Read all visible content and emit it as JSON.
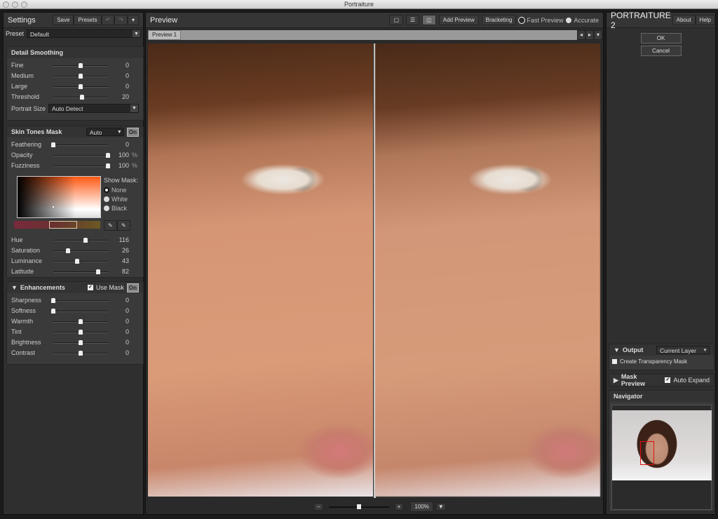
{
  "window": {
    "title": "Portraiture"
  },
  "settings": {
    "title": "Settings",
    "save": "Save",
    "presets": "Presets",
    "undo_icon": "undo-icon",
    "redo_icon": "redo-icon",
    "preset_label": "Preset",
    "preset_value": "Default"
  },
  "detail": {
    "title": "Detail Smoothing",
    "sliders": [
      {
        "label": "Fine",
        "value": "0",
        "pos": 0.5
      },
      {
        "label": "Medium",
        "value": "0",
        "pos": 0.5
      },
      {
        "label": "Large",
        "value": "0",
        "pos": 0.5
      },
      {
        "label": "Threshold",
        "value": "20",
        "pos": 0.52
      }
    ],
    "portrait_size_label": "Portrait Size",
    "portrait_size_value": "Auto Detect"
  },
  "skin": {
    "title": "Skin Tones Mask",
    "mode": "Auto",
    "on": "On",
    "sliders": [
      {
        "label": "Feathering",
        "value": "0",
        "pos": 0
      },
      {
        "label": "Opacity",
        "value": "100",
        "unit": "%",
        "pos": 1
      },
      {
        "label": "Fuzziness",
        "value": "100",
        "unit": "%",
        "pos": 1
      }
    ],
    "show_mask_label": "Show Mask:",
    "show_mask_options": [
      "None",
      "White",
      "Black"
    ],
    "show_mask_selected": "None",
    "color_sliders": [
      {
        "label": "Hue",
        "value": "116",
        "pos": 0.59
      },
      {
        "label": "Saturation",
        "value": "26",
        "pos": 0.27
      },
      {
        "label": "Luminance",
        "value": "43",
        "pos": 0.44
      },
      {
        "label": "Latitude",
        "value": "82",
        "pos": 0.82
      }
    ]
  },
  "enh": {
    "title": "Enhancements",
    "use_mask": "Use Mask",
    "use_mask_checked": true,
    "on": "On",
    "sliders": [
      {
        "label": "Sharpness",
        "value": "0",
        "pos": 0
      },
      {
        "label": "Softness",
        "value": "0",
        "pos": 0
      },
      {
        "label": "Warmth",
        "value": "0",
        "pos": 0.5
      },
      {
        "label": "Tint",
        "value": "0",
        "pos": 0.5
      },
      {
        "label": "Brightness",
        "value": "0",
        "pos": 0.5
      },
      {
        "label": "Contrast",
        "value": "0",
        "pos": 0.5
      }
    ]
  },
  "preview": {
    "title": "Preview",
    "add_preview": "Add Preview",
    "bracketing": "Bracketing",
    "fast_preview": "Fast Preview",
    "accurate": "Accurate",
    "mode_selected": "Accurate",
    "tab": "Preview 1",
    "zoom": "100%",
    "zoom_pos": 0.5
  },
  "right": {
    "brand": "PORTRAITURE 2",
    "about": "About",
    "help": "Help",
    "ok": "OK",
    "cancel": "Cancel",
    "output_title": "Output",
    "output_value": "Current Layer",
    "transparency": "Create Transparency Mask",
    "mask_preview": "Mask Preview",
    "auto_expand": "Auto Expand",
    "navigator": "Navigator"
  },
  "colors": {
    "navigator_box": "#e01010",
    "panel": "#2f2f2f"
  }
}
